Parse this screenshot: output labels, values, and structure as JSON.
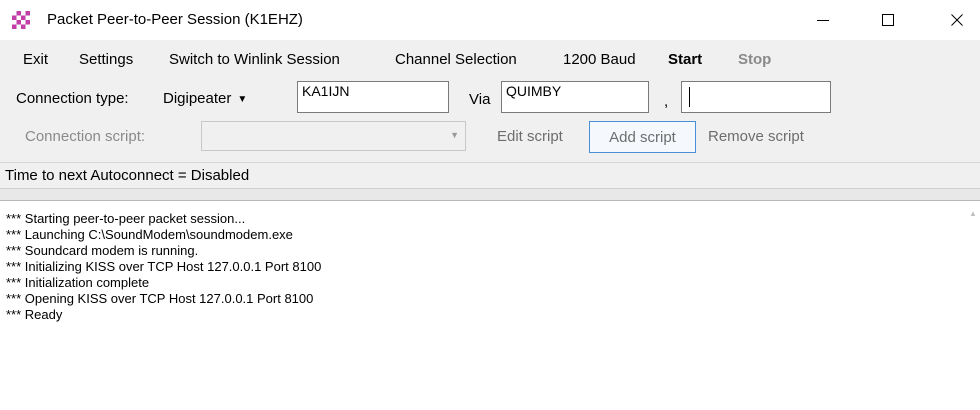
{
  "window": {
    "title": "Packet Peer-to-Peer Session  (K1EHZ)",
    "app_icon": "checkered-flag-icon",
    "controls": {
      "minimize": "minimize-icon",
      "maximize": "maximize-icon",
      "close": "close-icon"
    }
  },
  "menu": {
    "exit": "Exit",
    "settings": "Settings",
    "switch": "Switch to Winlink Session",
    "channel": "Channel Selection",
    "baud": "1200 Baud",
    "start": "Start",
    "stop": "Stop"
  },
  "connection": {
    "type_label": "Connection type:",
    "type_value": "Digipeater",
    "callsign": "KA1IJN",
    "via_label": "Via",
    "via_value": "QUIMBY",
    "comma": ",",
    "via2_value": ""
  },
  "script": {
    "label": "Connection script:",
    "value": "",
    "edit": "Edit script",
    "add": "Add script",
    "remove": "Remove script"
  },
  "status": {
    "text": "Time to next Autoconnect = Disabled"
  },
  "log": [
    "*** Starting peer-to-peer packet session...",
    "*** Launching C:\\SoundModem\\soundmodem.exe",
    "*** Soundcard modem is running.",
    "*** Initializing KISS over TCP Host 127.0.0.1 Port 8100",
    "*** Initialization complete",
    "*** Opening KISS over TCP Host 127.0.0.1 Port 8100",
    "*** Ready"
  ],
  "colors": {
    "toolbar_bg": "#f0f0f0",
    "disabled_text": "#8a8a8a",
    "focus_border": "#4a90d9"
  }
}
